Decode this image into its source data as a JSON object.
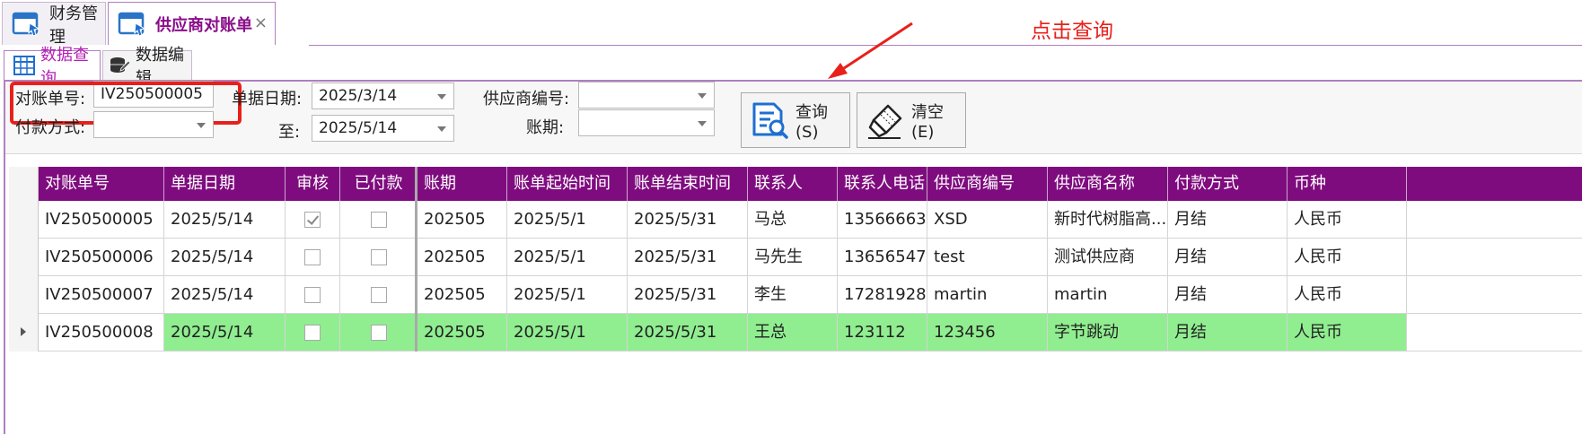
{
  "window_tabs": [
    {
      "label": "财务管理",
      "active": false
    },
    {
      "label": "供应商对账单",
      "active": true,
      "close": "×"
    }
  ],
  "sub_tabs": [
    {
      "label": "数据查询",
      "active": true
    },
    {
      "label": "数据编辑",
      "active": false
    }
  ],
  "filters": {
    "statement_no_label": "对账单号:",
    "statement_no_value": "IV250500005",
    "doc_date_label": "单据日期:",
    "doc_date_from": "2025/3/14",
    "to_label": "至:",
    "doc_date_to": "2025/5/14",
    "supplier_no_label": "供应商编号:",
    "supplier_no_value": "",
    "payment_method_label": "付款方式:",
    "payment_method_value": "",
    "period_label": "账期:",
    "period_value": ""
  },
  "buttons": {
    "query": "查询(S)",
    "clear": "清空(E)"
  },
  "annotation": "点击查询",
  "colors": {
    "accent": "#7f0c7f",
    "highlight_box": "#e8201b",
    "selected_row": "#90ee90",
    "tab_active_text": "#8a0d8a"
  },
  "grid": {
    "columns": [
      "对账单号",
      "单据日期",
      "审核",
      "已付款",
      "账期",
      "账单起始时间",
      "账单结束时间",
      "联系人",
      "联系人电话",
      "供应商编号",
      "供应商名称",
      "付款方式",
      "币种"
    ],
    "rows": [
      {
        "no": "IV250500005",
        "date": "2025/5/14",
        "audited": true,
        "paid": false,
        "period": "202505",
        "start": "2025/5/1",
        "end": "2025/5/31",
        "contact": "马总",
        "phone": "13566663...",
        "supplier_no": "XSD",
        "supplier_name": "新时代树脂高...",
        "pay": "月结",
        "currency": "人民币",
        "selected": false
      },
      {
        "no": "IV250500006",
        "date": "2025/5/14",
        "audited": false,
        "paid": false,
        "period": "202505",
        "start": "2025/5/1",
        "end": "2025/5/31",
        "contact": "马先生",
        "phone": "13656547...",
        "supplier_no": "test",
        "supplier_name": "测试供应商",
        "pay": "月结",
        "currency": "人民币",
        "selected": false
      },
      {
        "no": "IV250500007",
        "date": "2025/5/14",
        "audited": false,
        "paid": false,
        "period": "202505",
        "start": "2025/5/1",
        "end": "2025/5/31",
        "contact": "李生",
        "phone": "17281928...",
        "supplier_no": "martin",
        "supplier_name": "martin",
        "pay": "月结",
        "currency": "人民币",
        "selected": false
      },
      {
        "no": "IV250500008",
        "date": "2025/5/14",
        "audited": false,
        "paid": false,
        "period": "202505",
        "start": "2025/5/1",
        "end": "2025/5/31",
        "contact": "王总",
        "phone": "123112",
        "supplier_no": "123456",
        "supplier_name": "字节跳动",
        "pay": "月结",
        "currency": "人民币",
        "selected": true
      }
    ]
  }
}
